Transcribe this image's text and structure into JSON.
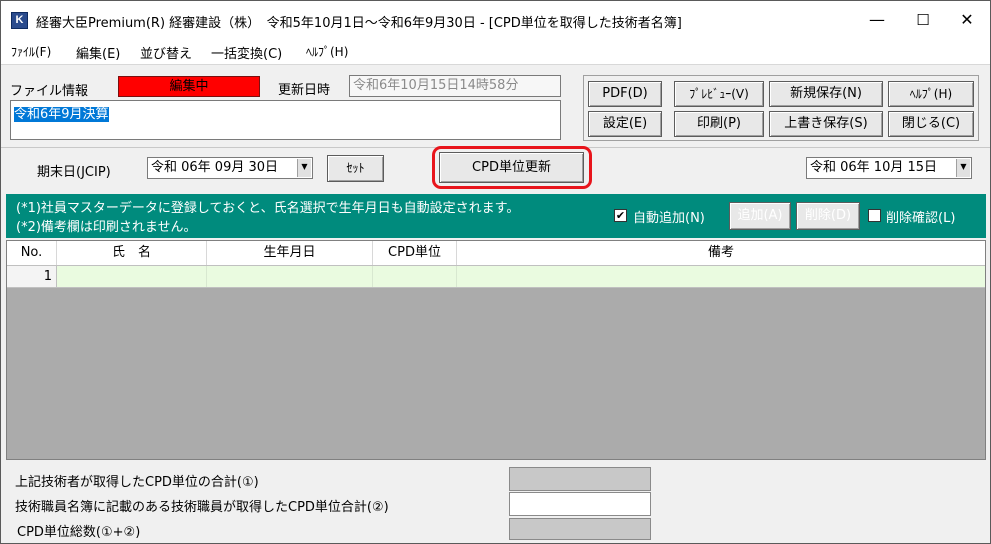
{
  "window": {
    "title": "経審大臣Premium(R) 経審建設（株）　令和5年10月1日～令和6年9月30日 - [CPD単位を取得した技術者名簿]",
    "app_icon_letter": "K",
    "minimize": "—",
    "maximize": "☐",
    "close": "✕"
  },
  "menu": [
    "ﾌｧｲﾙ(F)",
    "編集(E)",
    "並び替え",
    "一括変換(C)",
    "ﾍﾙﾌﾟ(H)"
  ],
  "file_info": {
    "label": "ファイル情報",
    "status": "編集中",
    "updated_label": "更新日時",
    "updated_value": "令和6年10月15日14時58分",
    "name_value": "令和6年9月決算"
  },
  "toolbar": {
    "pdf": "PDF(D)",
    "preview": "ﾌﾟﾚﾋﾞｭｰ(V)",
    "save_new": "新規保存(N)",
    "help": "ﾍﾙﾌﾟ(H)",
    "settings": "設定(E)",
    "print": "印刷(P)",
    "overwrite": "上書き保存(S)",
    "close": "閉じる(C)"
  },
  "period": {
    "label": "期末日(JCIP)",
    "value": "令和 06年 09月 30日",
    "set_button": "ｾｯﾄ",
    "cpd_update_button": "CPD単位更新",
    "right_date": "令和 06年 10月 15日"
  },
  "info_bar": {
    "line1": "(*1)社員マスターデータに登録しておくと、氏名選択で生年月日も自動設定されます。",
    "line2": "(*2)備考欄は印刷されません。",
    "auto_add_label": "自動追加(N)",
    "auto_add_checked": "✔",
    "add_button": "追加(A)",
    "delete_button": "削除(D)",
    "delete_confirm_label": "削除確認(L)"
  },
  "table": {
    "headers": [
      "No.",
      "氏　名",
      "生年月日",
      "CPD単位",
      "備考"
    ],
    "rows": [
      {
        "no": "1",
        "name": "",
        "birth": "",
        "cpd": "",
        "note": ""
      }
    ]
  },
  "footer": {
    "total1_label": "上記技術者が取得したCPD単位の合計(①)",
    "total2_label": "技術職員名簿に記載のある技術職員が取得したCPD単位合計(②)",
    "total_all_label": "CPD単位総数(①+②)",
    "total1_value": "",
    "total2_value": "",
    "total_all_value": ""
  },
  "colors": {
    "status_red": "#ff0000",
    "info_bar_teal": "#008b7d",
    "highlight_red": "#e8141b",
    "row_green": "#eafbe0"
  }
}
